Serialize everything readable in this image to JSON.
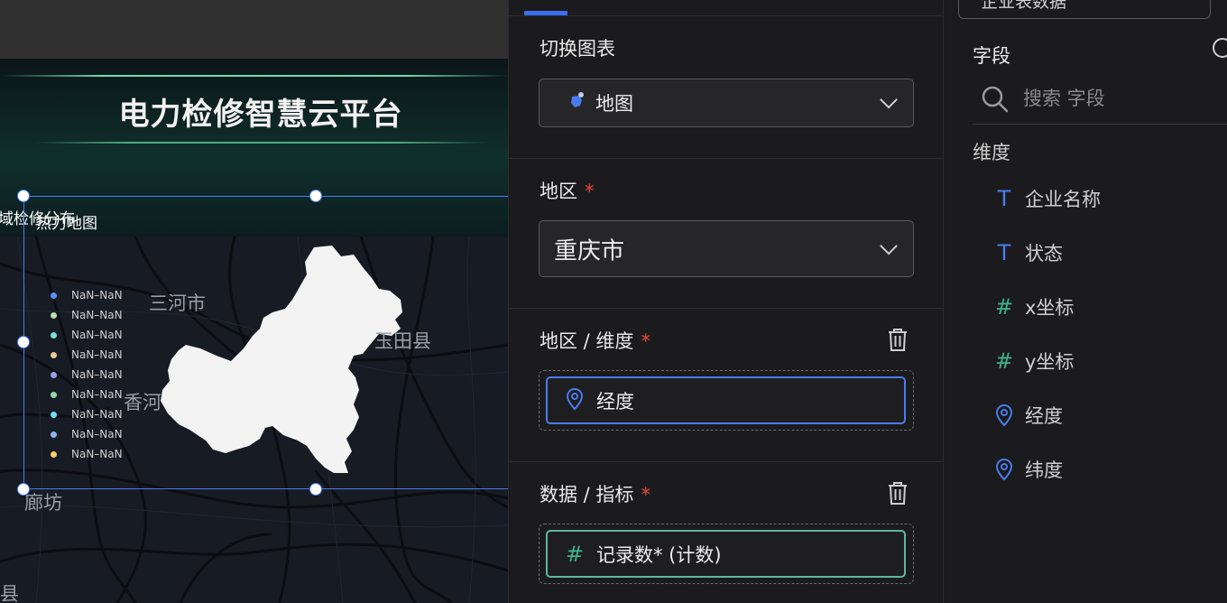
{
  "canvas": {
    "banner_title": "电力检修智慧云平台",
    "subheader_left": "域检修分布",
    "subheader_right": "热力地图",
    "map_labels": {
      "sanhe": "三河市",
      "yutian": "玉田县",
      "xianghe": "香河",
      "langfang": "廊坊",
      "xian": "县"
    },
    "legend": [
      {
        "label": "NaN–NaN",
        "color": "#5b8ff9"
      },
      {
        "label": "NaN–NaN",
        "color": "#b6e3a8"
      },
      {
        "label": "NaN–NaN",
        "color": "#7be0d5"
      },
      {
        "label": "NaN–NaN",
        "color": "#e8c894"
      },
      {
        "label": "NaN–NaN",
        "color": "#9a9fe6"
      },
      {
        "label": "NaN–NaN",
        "color": "#95d6a4"
      },
      {
        "label": "NaN–NaN",
        "color": "#6ee0f0"
      },
      {
        "label": "NaN–NaN",
        "color": "#8fb4f0"
      },
      {
        "label": "NaN–NaN",
        "color": "#f6cf6a"
      }
    ]
  },
  "config": {
    "switch_chart_label": "切换图表",
    "chart_type_value": "地图",
    "region_label": "地区",
    "region_value": "重庆市",
    "region_dimension_label": "地区 / 维度",
    "dimension_field": "经度",
    "data_metric_label": "数据 / 指标",
    "metric_field": "记录数* (计数)",
    "required_mark": "*"
  },
  "fields": {
    "datasource_value": "企业表数据",
    "title": "字段",
    "search_placeholder": "搜索 字段",
    "dimensions_title": "维度",
    "items": [
      {
        "label": "企业名称",
        "icon": "text-type-icon",
        "color": "#4a7cf0"
      },
      {
        "label": "状态",
        "icon": "text-type-icon",
        "color": "#4a7cf0"
      },
      {
        "label": "x坐标",
        "icon": "number-type-icon",
        "color": "#3fb28f"
      },
      {
        "label": "y坐标",
        "icon": "number-type-icon",
        "color": "#3fb28f"
      },
      {
        "label": "经度",
        "icon": "location-pin-icon",
        "color": "#4a7cf0"
      },
      {
        "label": "纬度",
        "icon": "location-pin-icon",
        "color": "#4a7cf0"
      }
    ]
  },
  "colors": {
    "accent": "#3c6cf0",
    "required": "#e5483e",
    "metric_border": "#5fb89a",
    "dimension_border": "#4a7cf0"
  }
}
